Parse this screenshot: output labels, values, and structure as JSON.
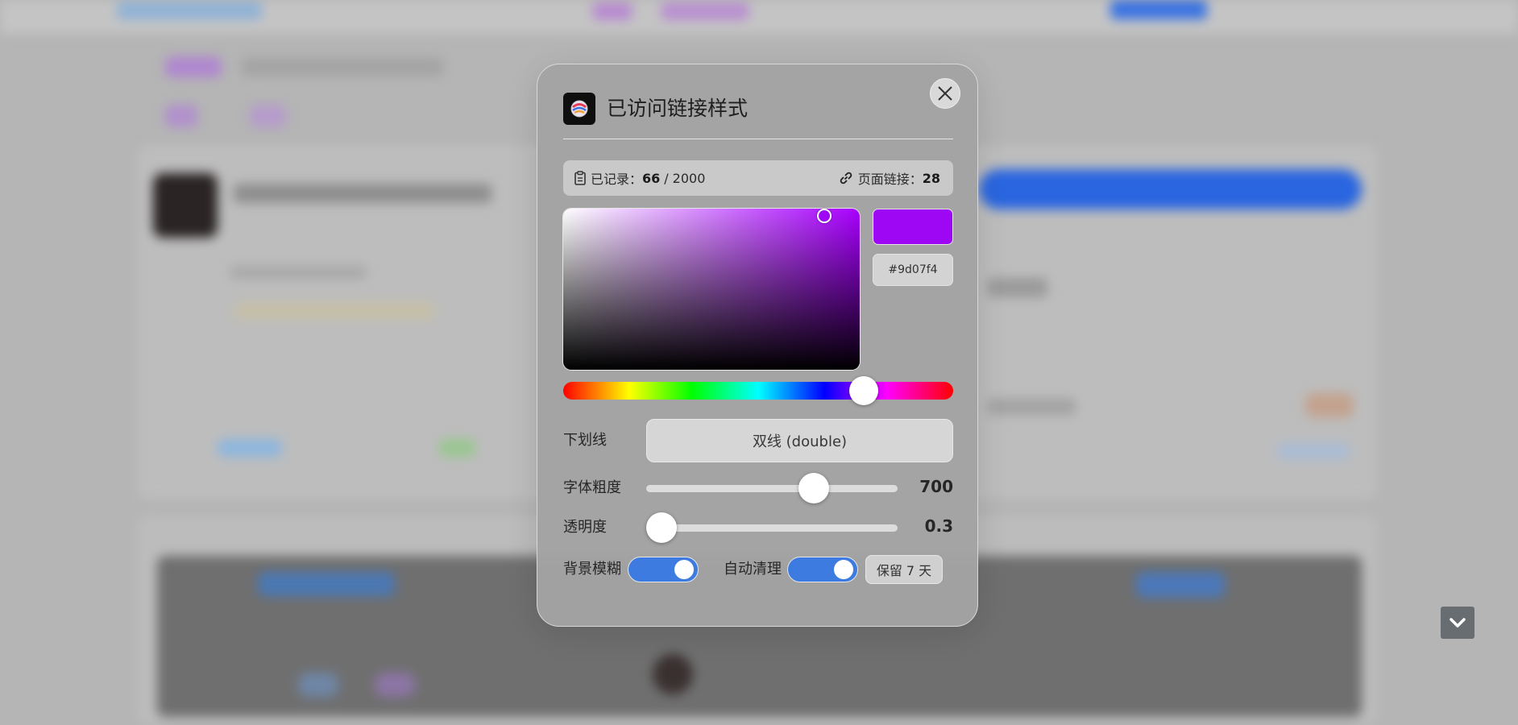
{
  "dialog": {
    "title": "已访问链接样式",
    "stats": {
      "recorded_label": "已记录：",
      "recorded_count": "66",
      "separator": "/",
      "recorded_max": "2000",
      "page_links_label": "页面链接：",
      "page_links_count": "28"
    },
    "color": {
      "hex": "#9d07f4",
      "hue_fraction": 0.77,
      "saturation": 0.97,
      "brightness": 0.96
    },
    "underline": {
      "label": "下划线",
      "value": "双线 (double)"
    },
    "font_weight": {
      "label": "字体粗度",
      "value": "700",
      "fraction": 0.69
    },
    "opacity": {
      "label": "透明度",
      "value": "0.3",
      "fraction": 0.0
    },
    "background_blur": {
      "label": "背景模糊",
      "on": true
    },
    "auto_clean": {
      "label": "自动清理",
      "on": true,
      "keep_label": "保留 7 天"
    }
  },
  "icons": {
    "app": "colorful-sticker-icon",
    "close": "close-icon",
    "recorded": "clipboard-icon",
    "links": "link-icon",
    "scroll": "chevron-down-icon"
  },
  "colors": {
    "accent": "#3d7be1",
    "selected_color": "#9d07f4"
  }
}
